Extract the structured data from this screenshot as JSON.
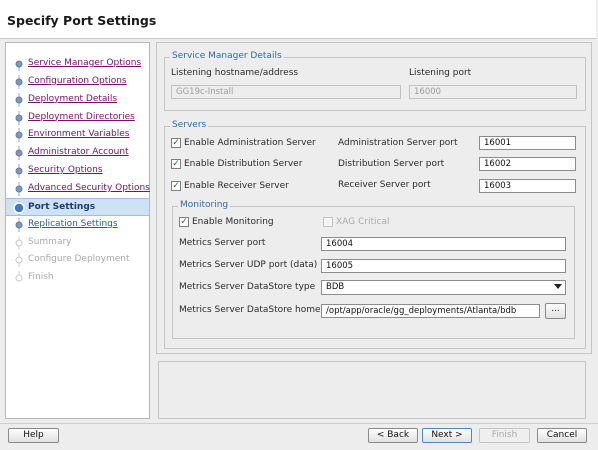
{
  "window": {
    "title": "Specify Port Settings"
  },
  "steps": [
    {
      "label": "Service Manager Options",
      "state": "done"
    },
    {
      "label": "Configuration Options",
      "state": "done"
    },
    {
      "label": "Deployment Details",
      "state": "done"
    },
    {
      "label": "Deployment Directories",
      "state": "done"
    },
    {
      "label": "Environment Variables",
      "state": "done"
    },
    {
      "label": "Administrator Account",
      "state": "done"
    },
    {
      "label": "Security Options",
      "state": "done"
    },
    {
      "label": "Advanced Security Options",
      "state": "done"
    },
    {
      "label": "Port Settings",
      "state": "current"
    },
    {
      "label": "Replication Settings",
      "state": "link"
    },
    {
      "label": "Summary",
      "state": "disabled"
    },
    {
      "label": "Configure Deployment",
      "state": "disabled"
    },
    {
      "label": "Finish",
      "state": "disabled"
    }
  ],
  "service_manager": {
    "legend": "Service Manager Details",
    "hostname_label": "Listening hostname/address",
    "hostname_value": "GG19c-Install",
    "port_label": "Listening port",
    "port_value": "16000"
  },
  "servers": {
    "legend": "Servers",
    "admin": {
      "checkbox_label": "Enable Administration Server",
      "port_label": "Administration Server port",
      "port_value": "16001",
      "checked": true
    },
    "distribution": {
      "checkbox_label": "Enable Distribution Server",
      "port_label": "Distribution Server port",
      "port_value": "16002",
      "checked": true
    },
    "receiver": {
      "checkbox_label": "Enable Receiver Server",
      "port_label": "Receiver Server port",
      "port_value": "16003",
      "checked": true
    }
  },
  "monitoring": {
    "legend": "Monitoring",
    "enable_label": "Enable Monitoring",
    "enable_checked": true,
    "xag_label": "XAG Critical",
    "xag_checked": false,
    "metrics_port_label": "Metrics Server port",
    "metrics_port_value": "16004",
    "metrics_udp_label": "Metrics Server UDP port (data)",
    "metrics_udp_value": "16005",
    "datastore_type_label": "Metrics Server DataStore type",
    "datastore_type_value": "BDB",
    "datastore_home_label": "Metrics Server DataStore home",
    "datastore_home_value": "/opt/app/oracle/gg_deployments/Atlanta/bdb",
    "browse_label": "..."
  },
  "buttons": {
    "help": "Help",
    "back": "< Back",
    "next": "Next >",
    "finish": "Finish",
    "cancel": "Cancel"
  },
  "check_glyph": "✓",
  "colors": {
    "current_step_bg": "#cfe1f5",
    "visited_link": "#7a0f6e",
    "legend_blue": "#2f6aa8"
  }
}
